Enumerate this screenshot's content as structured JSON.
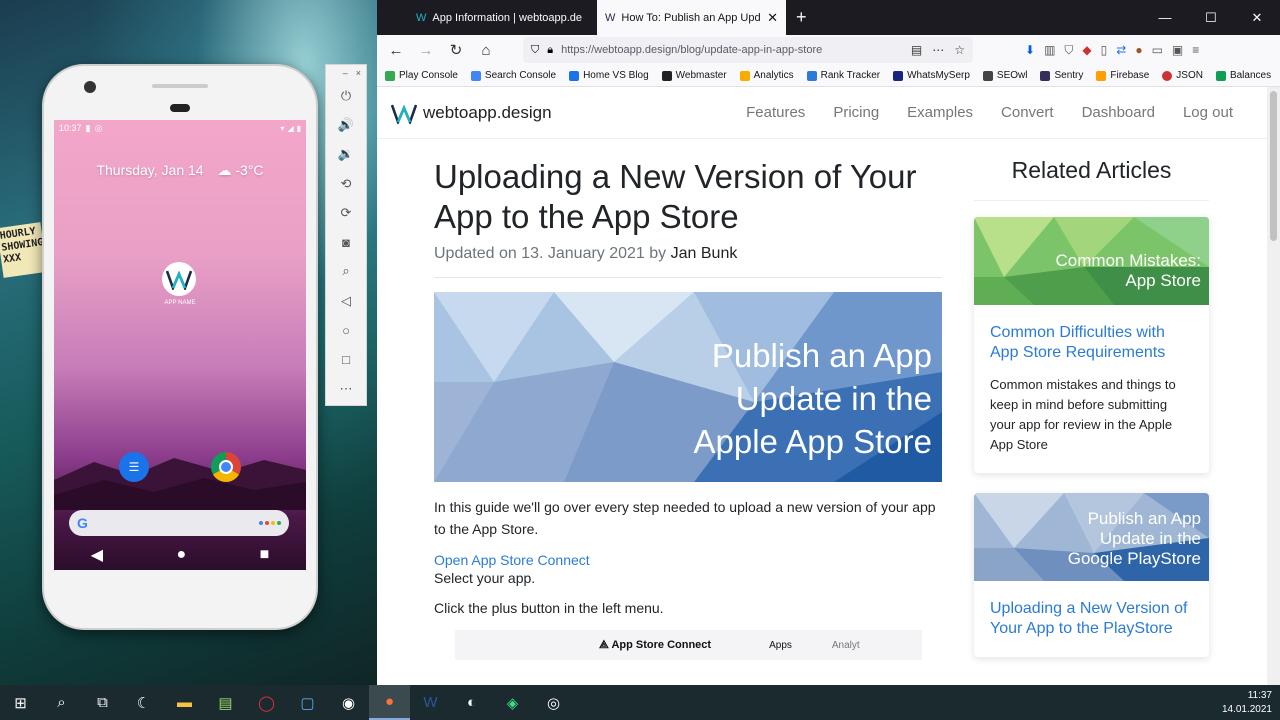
{
  "desktop": {
    "wallpaper_sign": "HOURLY\nSHOWING\nXXX"
  },
  "phone": {
    "status_time": "10:37",
    "date": "Thursday, Jan 14",
    "weather": "-3°C",
    "app_label": "APP NAME"
  },
  "browser": {
    "tabs": [
      {
        "title": "App Information | webtoapp.de"
      },
      {
        "title": "How To: Publish an App Update"
      }
    ],
    "url_host": "https://webtoapp.design",
    "url_path": "/blog/update-app-in-app-store",
    "bookmarks": [
      {
        "label": "Play Console",
        "color": "#34a853"
      },
      {
        "label": "Search Console",
        "color": "#4285f4"
      },
      {
        "label": "Home VS Blog",
        "color": "#1a73e8"
      },
      {
        "label": "Webmaster",
        "color": "#222222"
      },
      {
        "label": "Analytics",
        "color": "#f9ab00"
      },
      {
        "label": "Rank Tracker",
        "color": "#2b7bd6"
      },
      {
        "label": "WhatsMySerp",
        "color": "#1a237e"
      },
      {
        "label": "SEOwl",
        "color": "#444444"
      },
      {
        "label": "Sentry",
        "color": "#362d59"
      },
      {
        "label": "Firebase",
        "color": "#ffa000"
      },
      {
        "label": "JSON",
        "color": "#cc3333"
      },
      {
        "label": "Balances",
        "color": "#0f9d58"
      }
    ]
  },
  "site": {
    "brand": "webtoapp.design",
    "nav": [
      "Features",
      "Pricing",
      "Examples",
      "Convert",
      "Dashboard",
      "Log out"
    ],
    "article": {
      "title": "Uploading a New Version of Your App to the App Store",
      "updated_prefix": "Updated on 13. January 2021 by",
      "author": "Jan Bunk",
      "hero_text": [
        "Publish an App",
        "Update in the",
        "Apple App Store"
      ],
      "intro": "In this guide we'll go over every step needed to upload a new version of your app to the App Store.",
      "link": "Open App Store Connect",
      "step1": "Select your app.",
      "step2": "Click the plus button in the left menu.",
      "screenshot_title": "App Store Connect",
      "screenshot_apps": "Apps",
      "screenshot_analytics": "Analyt"
    },
    "related": {
      "heading": "Related Articles",
      "cards": [
        {
          "image_text": [
            "Common Mistakes:",
            "App Store"
          ],
          "title": "Common Difficulties with App Store Requirements",
          "desc": "Common mistakes and things to keep in mind before submitting your app for review in the Apple App Store"
        },
        {
          "image_text": [
            "Publish an App",
            "Update in the",
            "Google PlayStore"
          ],
          "title": "Uploading a New Version of Your App to the PlayStore",
          "desc": ""
        }
      ]
    }
  },
  "taskbar": {
    "time": "11:37",
    "date": "14.01.2021"
  }
}
